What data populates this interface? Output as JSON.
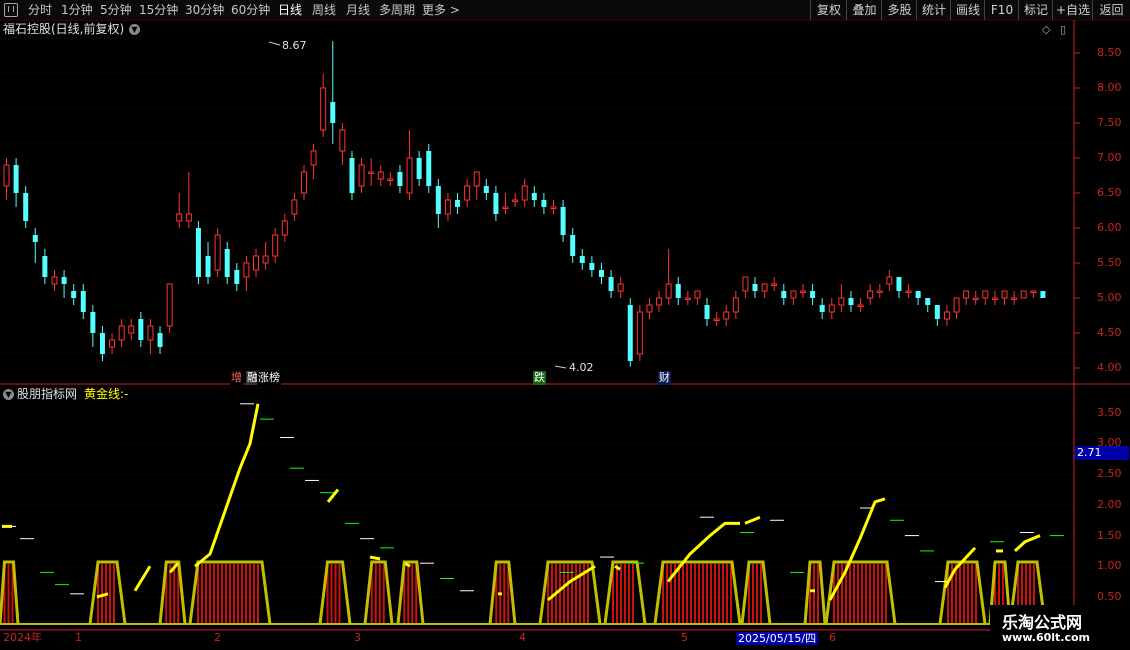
{
  "toolbar": {
    "periods": [
      "分时",
      "1分钟",
      "5分钟",
      "15分钟",
      "30分钟",
      "60分钟",
      "日线",
      "周线",
      "月线",
      "多周期",
      "更多 >"
    ],
    "active_period": "日线",
    "right_buttons": [
      "复权",
      "叠加",
      "多股",
      "统计",
      "画线",
      "F10",
      "标记",
      "+自选",
      "返回"
    ]
  },
  "main_panel": {
    "title": "福石控股(日线,前复权)",
    "max_label": "8.67",
    "min_label": "4.02",
    "markers": [
      "增",
      "融",
      "涨榜",
      "跌",
      "财"
    ],
    "y_ticks": [
      "8.50",
      "8.00",
      "7.50",
      "7.00",
      "6.50",
      "6.00",
      "5.50",
      "5.00",
      "4.50",
      "4.00"
    ]
  },
  "indicator_panel": {
    "name": "股朋指标网",
    "series_label": "黄金线:",
    "series_value": "-",
    "y_ticks": [
      "3.50",
      "3.00",
      "2.50",
      "2.00",
      "1.50",
      "1.00",
      "0.50"
    ],
    "current_value": "2.71"
  },
  "x_axis": {
    "labels": [
      "2024年",
      "1",
      "2",
      "3",
      "4",
      "5",
      "6"
    ],
    "cursor_date": "2025/05/15/四"
  },
  "watermark": {
    "line1": "乐淘公式网",
    "line2": "www.60lt.com"
  },
  "colors": {
    "up": "#ff3333",
    "down": "#54ffff",
    "gold_line": "#ffff00",
    "axis": "#cc2222",
    "band": "#c0c000"
  }
}
